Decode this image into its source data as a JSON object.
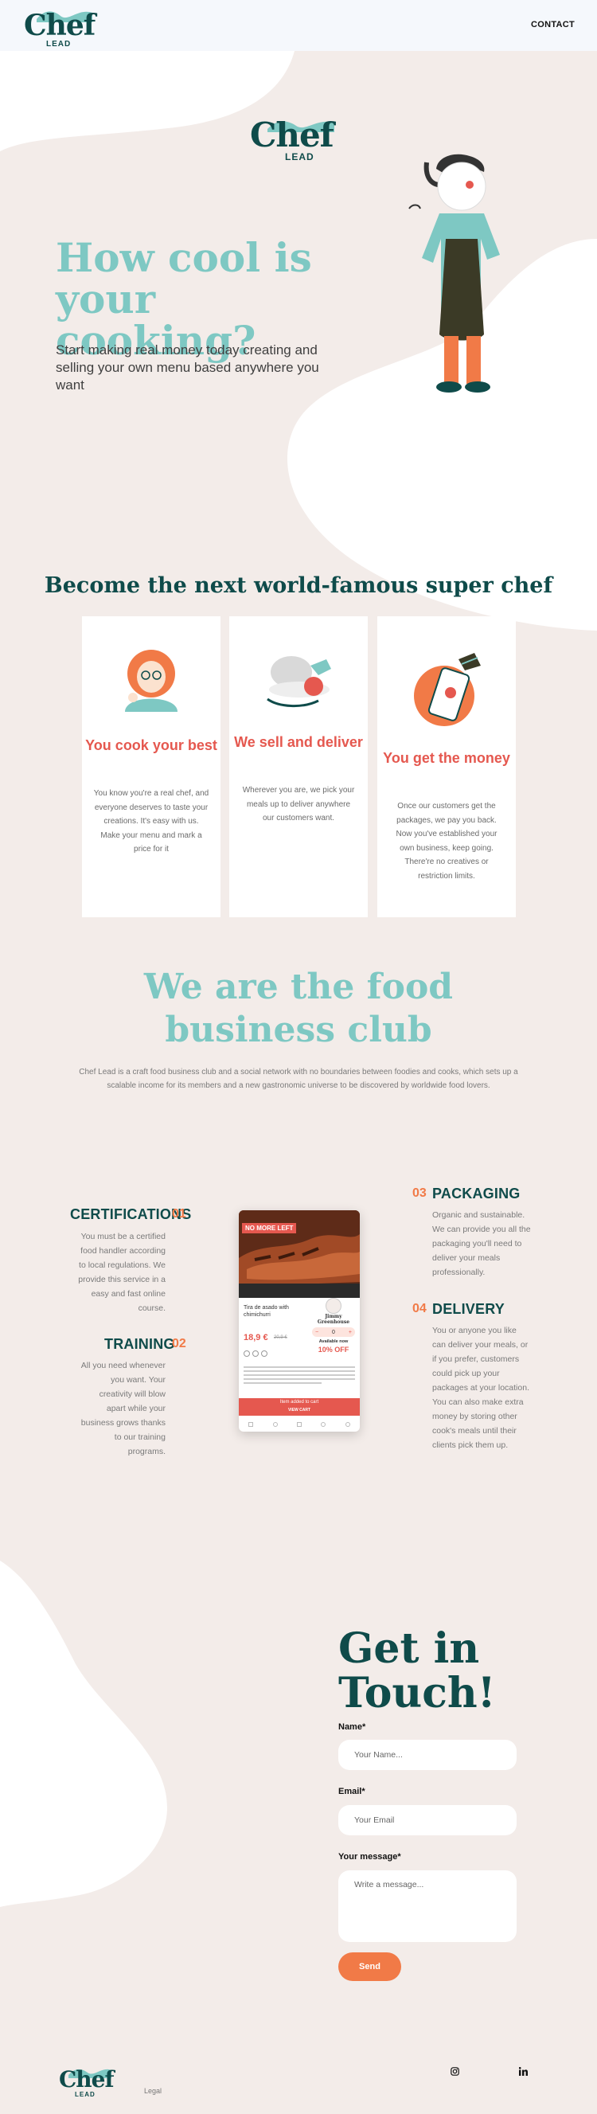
{
  "colors": {
    "brand": "#0f4b4a",
    "accent": "#7ec8c3",
    "orange": "#f17a47",
    "red": "#e5584f",
    "background": "#f3ece9"
  },
  "header": {
    "logo": {
      "word": "Chef",
      "sub": "LEAD"
    },
    "contact_label": "CONTACT"
  },
  "hero": {
    "logo": {
      "word": "Chef",
      "sub": "LEAD"
    },
    "title": "How cool is your cooking?",
    "subtitle": "Start making real money today creating and selling your own menu based anywhere you want"
  },
  "how": {
    "heading": "Become the next world-famous super chef",
    "cards": [
      {
        "icon": "chef-woman-icon",
        "title": "You cook your best",
        "text": "You know you're a real chef, and everyone deserves to taste your creations. It's easy with us. Make your menu and mark a price for it"
      },
      {
        "icon": "food-delivery-icon",
        "title": "We sell and deliver",
        "text": "Wherever you are, we pick your meals up to deliver anywhere our customers want."
      },
      {
        "icon": "money-phone-icon",
        "title": "You get the money",
        "text": "Once our customers get the packages, we pay you back. Now you've established your own business, keep going. There're no creatives or restriction limits."
      }
    ]
  },
  "club": {
    "heading": "We are the food business club",
    "text": "Chef Lead is a craft food business club and a social network with no boundaries between foodies and cooks, which sets up a scalable income for its members and a new gastronomic universe to be discovered by worldwide food lovers."
  },
  "features": {
    "certifications": {
      "title": "CERTIFICATIONS",
      "num": "01",
      "text": "You must be a certified food handler according to local regulations. We provide this service in a easy and fast online course."
    },
    "training": {
      "title": "TRAINING",
      "num": "02",
      "text": "All you need whenever you want. Your creativity will blow apart while your business grows thanks to our training programs."
    },
    "packaging": {
      "title": "PACKAGING",
      "num": "03",
      "text": "Organic and sustainable. We can provide you all the packaging you'll need to deliver your meals professionally."
    },
    "delivery": {
      "title": "DELIVERY",
      "num": "04",
      "text": "You or anyone you like can deliver your meals, or if you prefer, customers could pick up your packages at your location. You can also make extra money by storing other cook's meals until their clients pick them up."
    }
  },
  "phone": {
    "banner": "NO MORE LEFT",
    "dish_name": "Tira de asado with chimichurri",
    "price": "18,9 €",
    "old_price": "20,9 €",
    "chef_name": "Jimmy Greenhouse",
    "available": "Available now",
    "discount": "10% OFF",
    "qty": "0",
    "cta": "Item added to cart",
    "cta_sub": "VIEW CART"
  },
  "contact": {
    "heading": "Get in Touch!",
    "name_label": "Name*",
    "name_placeholder": "Your Name...",
    "email_label": "Email*",
    "email_placeholder": "Your Email",
    "message_label": "Your message*",
    "message_placeholder": "Write a message...",
    "send_label": "Send"
  },
  "footer": {
    "logo": {
      "word": "Chef",
      "sub": "LEAD"
    },
    "legal": "Legal",
    "social": [
      "instagram-icon",
      "linkedin-icon"
    ]
  }
}
